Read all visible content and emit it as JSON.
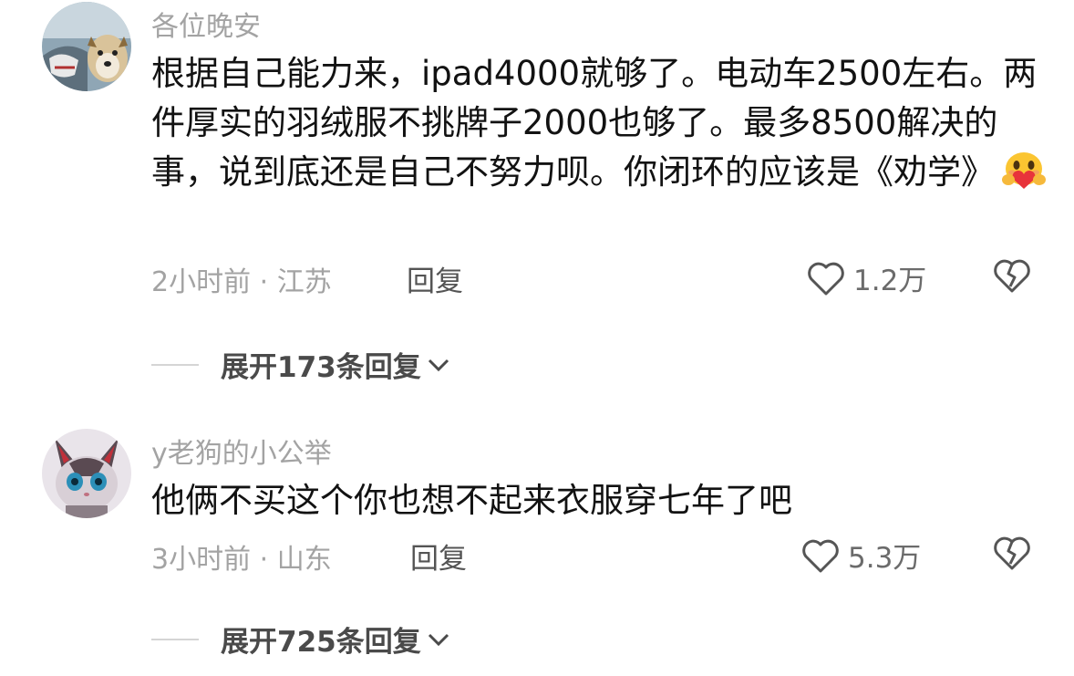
{
  "comments": [
    {
      "username": "各位晚安",
      "text": "根据自己能力来，ipad4000就够了。电动车2500左右。两件厚实的羽绒服不挑牌子2000也够了。最多8500解决的事，说到底还是自己不努力呗。你闭环的应该是《劝学》",
      "emoji": "hugging-face-emoji",
      "meta": "2小时前 · 江苏",
      "reply_label": "回复",
      "likes": "1.2万",
      "expand_label": "展开173条回复"
    },
    {
      "username": "y老狗的小公举",
      "text": "他俩不买这个你也想不起来衣服穿七年了吧",
      "meta": "3小时前 · 山东",
      "reply_label": "回复",
      "likes": "5.3万",
      "expand_label": "展开725条回复"
    }
  ],
  "icons": {
    "like": "heart-outline-icon",
    "dislike": "broken-heart-icon",
    "expand": "chevron-down-icon"
  },
  "colors": {
    "meta_gray": "#a3a3a3",
    "text": "#121212",
    "emoji_yellow": "#fbc531",
    "emoji_heart": "#e8333b"
  }
}
